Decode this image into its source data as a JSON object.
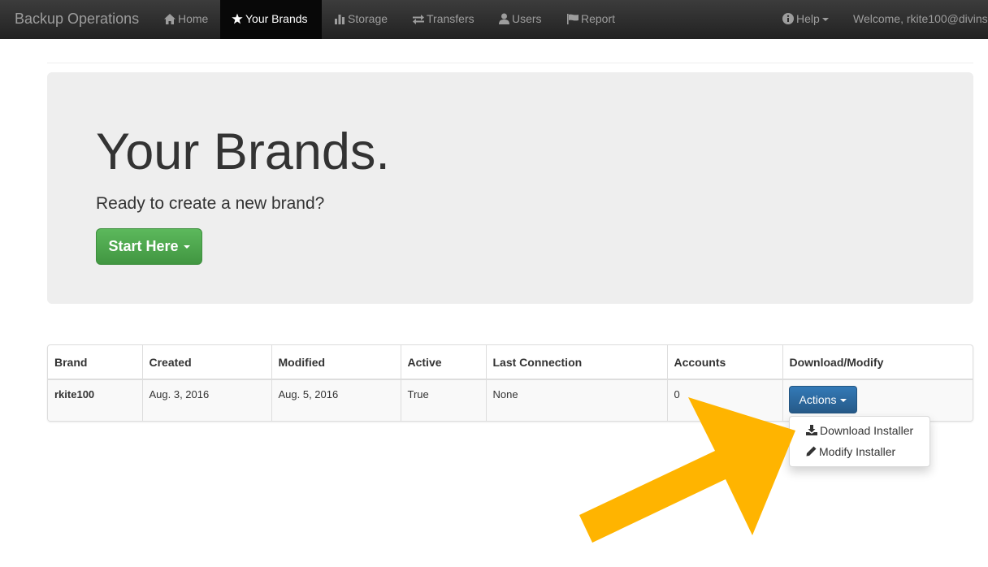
{
  "navbar": {
    "brand": "Backup Operations",
    "items": [
      {
        "label": "Home",
        "icon": "home-icon"
      },
      {
        "label": "Your Brands",
        "icon": "star-icon",
        "active": true
      },
      {
        "label": "Storage",
        "icon": "bar-chart-icon"
      },
      {
        "label": "Transfers",
        "icon": "transfer-icon"
      },
      {
        "label": "Users",
        "icon": "user-icon"
      },
      {
        "label": "Report",
        "icon": "flag-icon"
      }
    ],
    "help": {
      "label": "Help",
      "icon": "info-icon"
    },
    "welcome": "Welcome, rkite100@divins"
  },
  "jumbotron": {
    "title": "Your Brands.",
    "subtitle": "Ready to create a new brand?",
    "button_label": "Start Here",
    "button_color": "#5cb85c"
  },
  "table": {
    "columns": [
      "Brand",
      "Created",
      "Modified",
      "Active",
      "Last Connection",
      "Accounts",
      "Download/Modify"
    ],
    "rows": [
      {
        "brand": "rkite100",
        "created": "Aug. 3, 2016",
        "modified": "Aug. 5, 2016",
        "active": "True",
        "last_connection": "None",
        "accounts": "0"
      }
    ]
  },
  "actions": {
    "button_label": "Actions",
    "button_color": "#337ab7",
    "menu": [
      {
        "label": "Download Installer",
        "icon": "download-icon"
      },
      {
        "label": "Modify Installer",
        "icon": "pencil-icon"
      }
    ]
  },
  "annotation": {
    "arrow_color": "#ffb400",
    "arrow_icon": "arrow-annotation-icon"
  }
}
